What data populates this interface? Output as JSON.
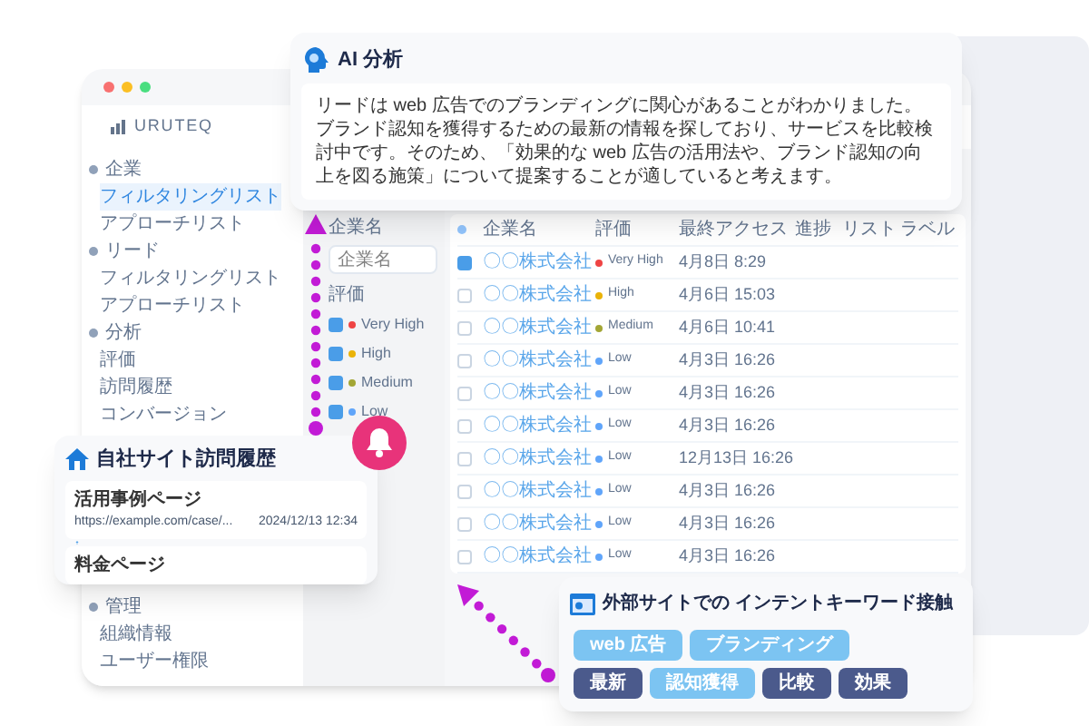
{
  "app": {
    "logo": "URUTEQ",
    "sidebar": [
      {
        "label": "企業",
        "children": [
          {
            "label": "フィルタリングリスト",
            "selected": true
          },
          {
            "label": "アプローチリスト",
            "selected": false
          }
        ]
      },
      {
        "label": "リード",
        "children": [
          {
            "label": "フィルタリングリスト",
            "selected": false
          },
          {
            "label": "アプローチリスト",
            "selected": false
          }
        ]
      },
      {
        "label": "分析",
        "children": [
          {
            "label": "評価",
            "selected": false
          },
          {
            "label": "訪問履歴",
            "selected": false
          },
          {
            "label": "コンバージョン",
            "selected": false
          }
        ]
      },
      {
        "label": "管理",
        "children": [
          {
            "label": "組織情報",
            "selected": false
          },
          {
            "label": "ユーザー権限",
            "selected": false
          }
        ]
      }
    ],
    "filter": {
      "company_label": "企業名",
      "company_placeholder": "企業名",
      "rating_label": "評価",
      "options": [
        {
          "label": "Very High",
          "checked": true,
          "color": "#ef4444"
        },
        {
          "label": "High",
          "checked": true,
          "color": "#eab308"
        },
        {
          "label": "Medium",
          "checked": true,
          "color": "#a3a635"
        },
        {
          "label": "Low",
          "checked": true,
          "color": "#60a5fa"
        }
      ]
    },
    "table": {
      "columns": [
        "企業名",
        "評価",
        "最終アクセス",
        "進捗",
        "リスト",
        "ラベル"
      ],
      "rows": [
        {
          "checked": true,
          "company": "〇〇株式会社",
          "rating": "Very High",
          "color": "#ef4444",
          "last_access": "4月8日 8:29"
        },
        {
          "checked": false,
          "company": "〇〇株式会社",
          "rating": "High",
          "color": "#eab308",
          "last_access": "4月6日 15:03"
        },
        {
          "checked": false,
          "company": "〇〇株式会社",
          "rating": "Medium",
          "color": "#a3a635",
          "last_access": "4月6日 10:41"
        },
        {
          "checked": false,
          "company": "〇〇株式会社",
          "rating": "Low",
          "color": "#60a5fa",
          "last_access": "4月3日 16:26"
        },
        {
          "checked": false,
          "company": "〇〇株式会社",
          "rating": "Low",
          "color": "#60a5fa",
          "last_access": "4月3日 16:26"
        },
        {
          "checked": false,
          "company": "〇〇株式会社",
          "rating": "Low",
          "color": "#60a5fa",
          "last_access": "4月3日 16:26"
        },
        {
          "checked": false,
          "company": "〇〇株式会社",
          "rating": "Low",
          "color": "#60a5fa",
          "last_access": "12月13日 16:26"
        },
        {
          "checked": false,
          "company": "〇〇株式会社",
          "rating": "Low",
          "color": "#60a5fa",
          "last_access": "4月3日 16:26"
        },
        {
          "checked": false,
          "company": "〇〇株式会社",
          "rating": "Low",
          "color": "#60a5fa",
          "last_access": "4月3日 16:26"
        },
        {
          "checked": false,
          "company": "〇〇株式会社",
          "rating": "Low",
          "color": "#60a5fa",
          "last_access": "4月3日 16:26"
        }
      ]
    }
  },
  "ai_card": {
    "title": "AI 分析",
    "text": "リードは web 広告でのブランディングに関心があることがわかりました。ブランド認知を獲得するための最新の情報を探しており、サービスを比較検討中です。そのため、「効果的な web 広告の活用法や、ブランド認知の向上を図る施策」について提案することが適していると考えます。"
  },
  "visit_card": {
    "title": "自社サイト訪問履歴",
    "pages": [
      {
        "title": "活用事例ページ",
        "url": "https://example.com/case/...",
        "time": "2024/12/13 12:34"
      },
      {
        "title": "料金ページ"
      }
    ]
  },
  "intent_card": {
    "title": "外部サイトでの インテントキーワード接触",
    "keywords": [
      {
        "label": "web 広告",
        "color": "#7cc4f2"
      },
      {
        "label": "ブランディング",
        "color": "#7cc4f2"
      },
      {
        "label": "最新",
        "color": "#4b5a8c"
      },
      {
        "label": "認知獲得",
        "color": "#7cc4f2"
      },
      {
        "label": "比較",
        "color": "#4b5a8c"
      },
      {
        "label": "効果",
        "color": "#4b5a8c"
      }
    ]
  }
}
